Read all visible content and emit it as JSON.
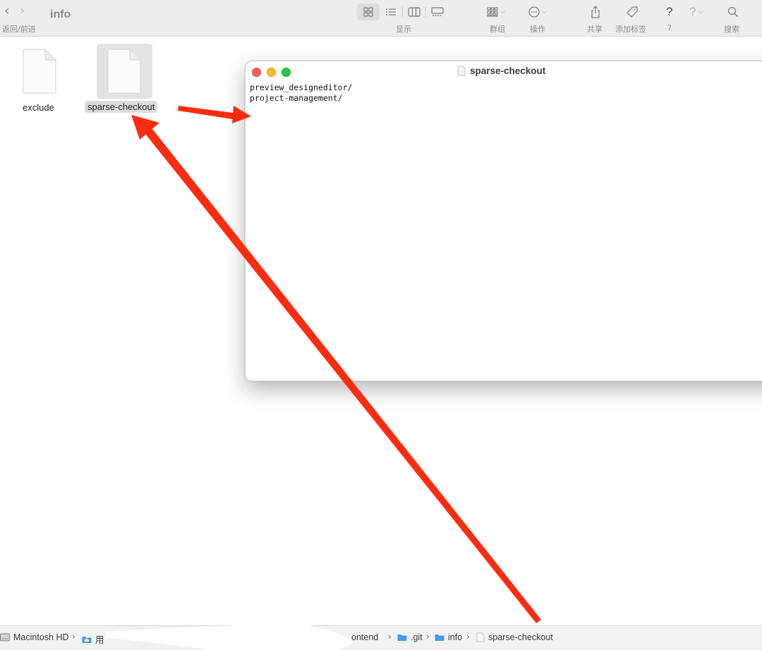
{
  "finder": {
    "window_title": "info",
    "nav_label": "返回/前进",
    "toolbar": {
      "display_label": "显示",
      "group_label": "群组",
      "action_label": "操作",
      "share_label": "共享",
      "tags_label": "添加标签",
      "help_label": "?",
      "search_label": "搜索",
      "help_glyph": "?",
      "help_glyph_alt": "?"
    },
    "files": [
      {
        "name": "exclude",
        "icon": "document-icon",
        "selected": false
      },
      {
        "name": "sparse-checkout",
        "icon": "document-icon",
        "selected": true
      }
    ],
    "path_bar": [
      {
        "label": "Macintosh HD",
        "icon": "hard-drive-icon"
      },
      {
        "label": "用",
        "icon": "home-folder-icon"
      },
      {
        "label": "ontend",
        "icon": "none"
      },
      {
        "label": ".git",
        "icon": "folder-icon"
      },
      {
        "label": "info",
        "icon": "folder-icon"
      },
      {
        "label": "sparse-checkout",
        "icon": "document-icon"
      }
    ]
  },
  "editor": {
    "title": "sparse-checkout",
    "lines": [
      "preview_designeditor/",
      "project-management/"
    ]
  },
  "colors": {
    "annotation_arrow": "#fc2c10",
    "selection": "#dcdcdc",
    "folder_blue": "#4a9be8",
    "traffic_red": "#ff5f57",
    "traffic_yellow": "#febc2e",
    "traffic_green": "#28c840"
  }
}
